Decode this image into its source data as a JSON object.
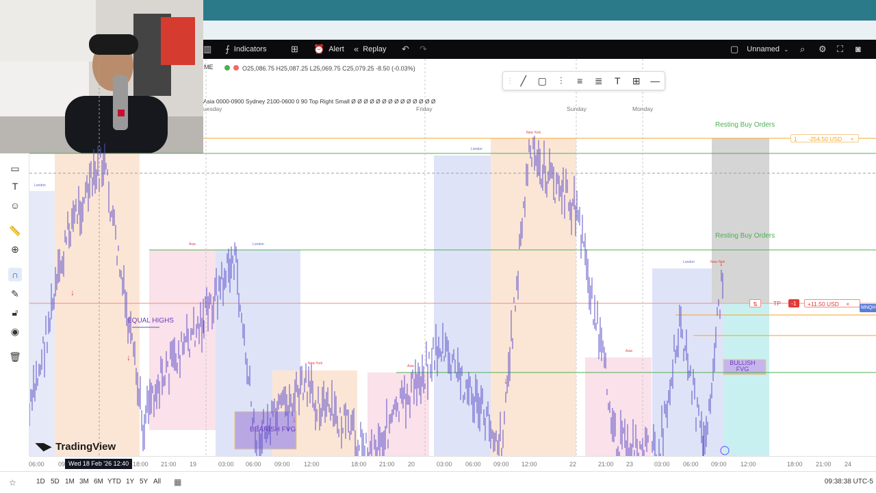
{
  "toolbar": {
    "indicators": "Indicators",
    "alert": "Alert",
    "replay": "Replay",
    "layout_name": "Unnamed"
  },
  "symbol": {
    "ticker": "ME",
    "ohlc": "O25,086.75  H25,087.25  L25,069.75  C25,079.25  -8.50 (-0.03%)"
  },
  "session_legend": "Asia 0000-0900 Sydney 2100-0600 0 90 Top Right Small  Ø Ø Ø Ø Ø Ø Ø Ø Ø Ø Ø Ø Ø Ø",
  "day_labels": {
    "tuesday": "uesday",
    "friday": "Friday",
    "sunday": "Sunday",
    "monday": "Monday"
  },
  "session_tags": {
    "london": "London",
    "asia": "Asia",
    "new_york": "New York"
  },
  "annotations": {
    "resting_buy_1": "Resting Buy Orders",
    "resting_buy_2": "Resting Buy Orders",
    "equal_highs": "EQUAL HIGHS",
    "bearish_fvg": "BEARISH FVG",
    "bullish_fvg": "BULLISH FVG"
  },
  "orders": {
    "sl_qty": "1",
    "sl_pnl": "-254.50 USD",
    "tp_label": "TP",
    "tp_qty": "-1",
    "tp_pnl": "+11.50 USD",
    "price_tag": "MNQH"
  },
  "crosshair_time": "Wed 18 Feb '26   12:40",
  "time_ticks": [
    "06:00",
    "09:00",
    "18:00",
    "21:00",
    "19",
    "03:00",
    "06:00",
    "09:00",
    "12:00",
    "18:00",
    "21:00",
    "20",
    "03:00",
    "06:00",
    "09:00",
    "12:00",
    "22",
    "21:00",
    "23",
    "03:00",
    "06:00",
    "09:00",
    "12:00",
    "18:00",
    "21:00",
    "24"
  ],
  "ranges": [
    "1D",
    "5D",
    "1M",
    "3M",
    "6M",
    "YTD",
    "1Y",
    "5Y",
    "All"
  ],
  "clock": "09:38:38 UTC-5",
  "brand": "TradingView",
  "colors": {
    "tabbar": "#2b7a8a",
    "topbar": "#0b0b0d",
    "candles": "#5b4fc9",
    "london_box": "#dfe4f7",
    "ny_box": "#f9e1d0",
    "asia_box": "#f9dde7",
    "resting_level": "#4caf50",
    "sl_line": "#f5a623",
    "tp_line": "#f28b82"
  }
}
